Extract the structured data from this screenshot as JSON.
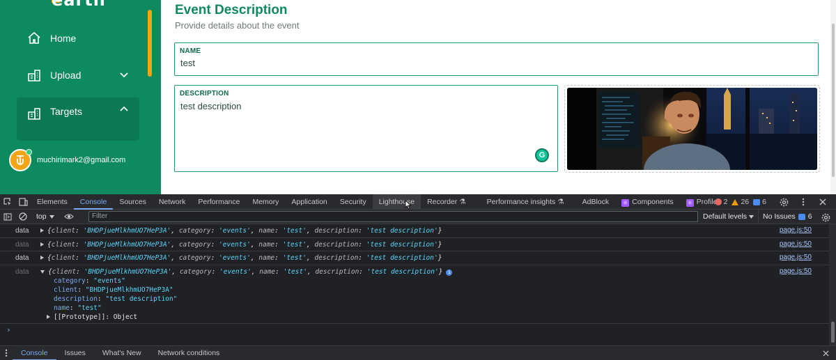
{
  "sidebar": {
    "logo_text": "earth",
    "items": [
      {
        "label": "Home",
        "icon": "home-icon"
      },
      {
        "label": "Upload",
        "icon": "upload-icon"
      },
      {
        "label": "Targets",
        "icon": "targets-icon"
      }
    ],
    "user_email": "muchirimark2@gmail.com"
  },
  "main": {
    "title": "Event Description",
    "subtitle": "Provide details about the event",
    "name_label": "NAME",
    "name_value": "test",
    "description_label": "DESCRIPTION",
    "description_value": "test description",
    "grammarly_letter": "G"
  },
  "devtools": {
    "tabs": [
      "Elements",
      "Console",
      "Sources",
      "Network",
      "Performance",
      "Memory",
      "Application",
      "Security",
      "Lighthouse",
      "Recorder",
      "Performance insights",
      "AdBlock",
      "Components",
      "Profiler"
    ],
    "active_tab": "Console",
    "errors": "2",
    "warnings": "26",
    "infos": "6",
    "context": "top",
    "filter_placeholder": "Filter",
    "levels": "Default levels",
    "issues_label": "No Issues",
    "issues_count": "6",
    "logs": [
      {
        "label": "data",
        "client": "'BHDPjueMlkhmUO7HeP3A'",
        "category": "'events'",
        "name": "'test'",
        "description": "'test description'",
        "source": "page.js:50"
      },
      {
        "label": "data",
        "client": "'BHDPjueMlkhmUO7HeP3A'",
        "category": "'events'",
        "name": "'test'",
        "description": "'test description'",
        "source": "page.js:50"
      },
      {
        "label": "data",
        "client": "'BHDPjueMlkhmUO7HeP3A'",
        "category": "'events'",
        "name": "'test'",
        "description": "'test description'",
        "source": "page.js:50"
      },
      {
        "label": "data",
        "client": "'BHDPjueMlkhmUO7HeP3A'",
        "category": "'events'",
        "name": "'test'",
        "description": "'test description'",
        "source": "page.js:50"
      }
    ],
    "expanded": {
      "category": "\"events\"",
      "client": "\"BHDPjueMlkhmUO7HeP3A\"",
      "description": "\"test description\"",
      "name": "\"test\"",
      "prototype": "[[Prototype]]: Object"
    },
    "drawer_tabs": [
      "Console",
      "Issues",
      "What's New",
      "Network conditions"
    ]
  },
  "colors": {
    "sidebar": "#0e8a5f",
    "accent": "#f2a516",
    "devtools_bg": "#202124",
    "link": "#7cacf8"
  }
}
